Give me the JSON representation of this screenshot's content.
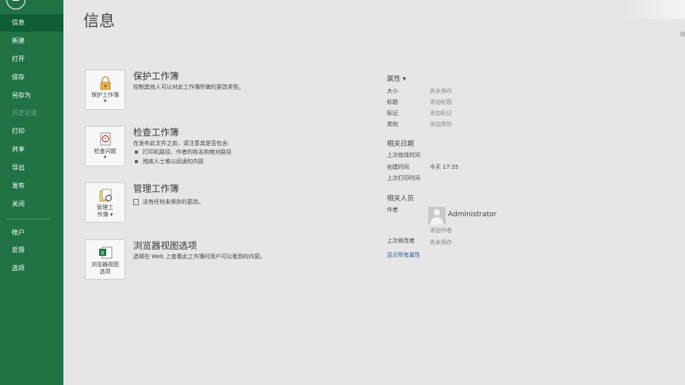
{
  "sidebar": {
    "items": [
      {
        "label": "信息"
      },
      {
        "label": "新建"
      },
      {
        "label": "打开"
      },
      {
        "label": "保存"
      },
      {
        "label": "另存为"
      },
      {
        "label": "历史记录"
      },
      {
        "label": "打印"
      },
      {
        "label": "共享"
      },
      {
        "label": "导出"
      },
      {
        "label": "发布"
      },
      {
        "label": "关闭"
      },
      {
        "label": "帐户"
      },
      {
        "label": "反馈"
      },
      {
        "label": "选项"
      }
    ]
  },
  "page_title": "信息",
  "sections": {
    "protect": {
      "tile_line1": "保护工作簿",
      "title": "保护工作簿",
      "desc": "控制其他人可以对此工作簿所做的更改类型。"
    },
    "inspect": {
      "tile_line1": "检查问题",
      "title": "检查工作簿",
      "desc": "在发布此文件之前，请注意其是否包含:",
      "bullets": [
        "打印机路径、作者的姓名和绝对路径",
        "残疾人士难以阅读的内容"
      ]
    },
    "manage": {
      "tile_line1": "管理工",
      "tile_line2": "作簿",
      "title": "管理工作簿",
      "bullet": "没有任何未保存的更改。"
    },
    "browser": {
      "tile_line1": "浏览器视图",
      "tile_line2": "选项",
      "title": "浏览器视图选项",
      "desc": "选择在 Web 上查看此工作簿时用户可以看到的内容。"
    }
  },
  "properties": {
    "header": "属性",
    "rows": [
      {
        "key": "大小",
        "value": "尚未保存"
      },
      {
        "key": "标题",
        "value": "添加标题"
      },
      {
        "key": "标记",
        "value": "添加标记"
      },
      {
        "key": "类别",
        "value": "添加类别"
      }
    ],
    "dates_header": "相关日期",
    "dates": [
      {
        "key": "上次修改时间",
        "value": ""
      },
      {
        "key": "创建时间",
        "value": "今天 17:35"
      },
      {
        "key": "上次打印时间",
        "value": ""
      }
    ],
    "people_header": "相关人员",
    "author_label": "作者",
    "author_name": "Administrator",
    "add_author": "添加作者",
    "last_modified_by_label": "上次修改者",
    "last_modified_by_value": "尚未保存",
    "show_all": "显示所有属性"
  }
}
